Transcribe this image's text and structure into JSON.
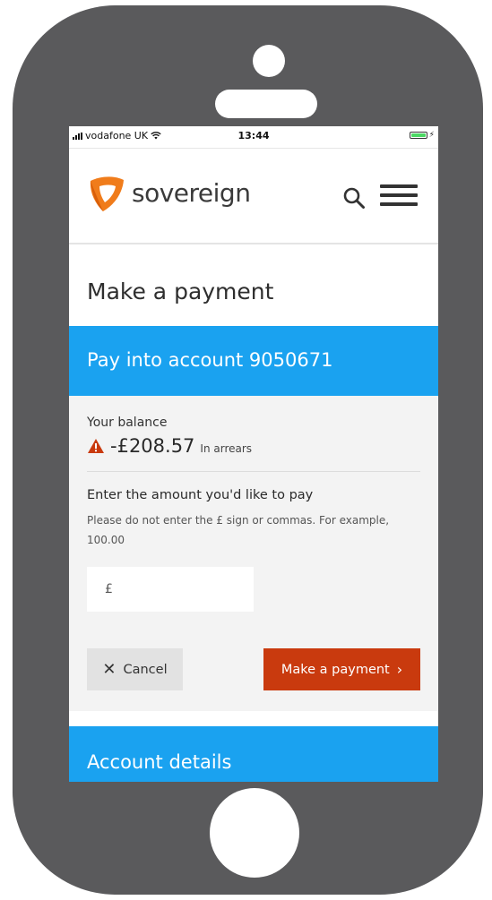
{
  "status_bar": {
    "carrier": "vodafone UK",
    "time": "13:44",
    "battery_level": 1.0
  },
  "header": {
    "logo_text": "sovereign",
    "brand_color": "#f07c1b",
    "search_icon": "search-icon",
    "menu_icon": "hamburger-menu-icon"
  },
  "page": {
    "title": "Make a payment"
  },
  "account": {
    "heading": "Pay into account 9050671",
    "color": "#1aa2f0"
  },
  "balance": {
    "label": "Your balance",
    "amount": "-£208.57",
    "status": "In arrears",
    "warning_icon": "warning-icon",
    "warning_color": "#c93a0e"
  },
  "payment_form": {
    "amount_label": "Enter the amount you'd like to pay",
    "help_text": "Please do not enter the £ sign or commas. For example, 100.00",
    "amount_placeholder": "£",
    "amount_value": "",
    "cancel_label": "Cancel",
    "submit_label": "Make a payment",
    "submit_color": "#c93a0e"
  },
  "account_details": {
    "heading": "Account details"
  }
}
